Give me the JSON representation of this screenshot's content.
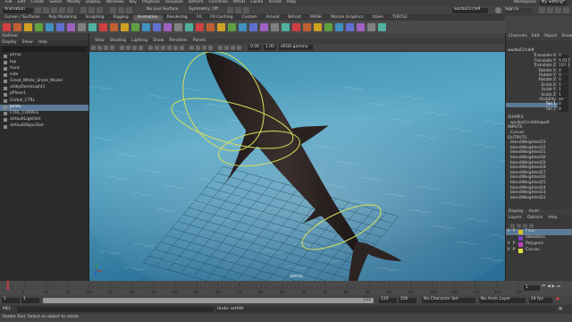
{
  "menubar": {
    "items": [
      "File",
      "Edit",
      "Create",
      "Select",
      "Modify",
      "Display",
      "Windows",
      "Key",
      "Playback",
      "Visualize",
      "Deform",
      "Constrain",
      "MASH",
      "Cache",
      "Arnold",
      "Help"
    ],
    "workspace_label": "Workspace:",
    "workspace_value": "My Setting*"
  },
  "statusline": {
    "mode": "Animation",
    "no_live_surface": "No Live Surface",
    "symmetry": "Symmetry: Off",
    "search_field": "wurboCircle9",
    "sign_in": "Sign In"
  },
  "shelf": {
    "tabs": [
      "Curves / Surfaces",
      "Poly Modeling",
      "Sculpting",
      "Rigging",
      "Animation",
      "Rendering",
      "FX",
      "FX Caching",
      "Custom",
      "Arnold",
      "Bifrost",
      "MASH",
      "Motion Graphics",
      "XGen",
      "TURTLE"
    ],
    "active_tab": "Animation"
  },
  "outliner": {
    "title": "Outliner",
    "menus": [
      "Display",
      "Show",
      "Help"
    ],
    "items": [
      {
        "label": "persp",
        "selected": false
      },
      {
        "label": "top",
        "selected": false
      },
      {
        "label": "front",
        "selected": false
      },
      {
        "label": "side",
        "selected": false
      },
      {
        "label": "Great_White_Shark_Model",
        "selected": false
      },
      {
        "label": "aiSkyDomeLight1",
        "selected": false
      },
      {
        "label": "pPlane1",
        "selected": false
      },
      {
        "label": "Global_CTRL",
        "selected": false
      },
      {
        "label": "Joints",
        "selected": true
      },
      {
        "label": "CTRL_CURVES",
        "selected": false
      },
      {
        "label": "defaultLightSet",
        "selected": false
      },
      {
        "label": "defaultObjectSet",
        "selected": false
      }
    ]
  },
  "viewport": {
    "menus": [
      "View",
      "Shading",
      "Lighting",
      "Show",
      "Renderer",
      "Panels"
    ],
    "field_a": "0.00",
    "field_b": "1.00",
    "colorspace": "sRGB gamma",
    "camera_label": "persp",
    "colors": {
      "water_top": "#3e8fb0",
      "water_mid": "#5aa8c6",
      "water_bottom": "#2a6f96",
      "shark_body": "#2f2826",
      "control_curve": "#d6e05a"
    }
  },
  "channelbox": {
    "tabs": [
      "Channels",
      "Edit",
      "Object",
      "Show"
    ],
    "node_name": "wurboCircle9",
    "channels": [
      {
        "name": "Translate X",
        "value": "0",
        "highlight": false
      },
      {
        "name": "Translate Y",
        "value": "5.017",
        "highlight": false
      },
      {
        "name": "Translate Z",
        "value": "107.1",
        "highlight": false
      },
      {
        "name": "Rotate X",
        "value": "0",
        "highlight": false
      },
      {
        "name": "Rotate Y",
        "value": "0",
        "highlight": false
      },
      {
        "name": "Rotate Z",
        "value": "0",
        "highlight": false
      },
      {
        "name": "Scale X",
        "value": "1",
        "highlight": false
      },
      {
        "name": "Scale Y",
        "value": "1",
        "highlight": false
      },
      {
        "name": "Scale Z",
        "value": "1",
        "highlight": false
      },
      {
        "name": "Visibility",
        "value": "on",
        "highlight": false
      },
      {
        "name": "Tail 1",
        "value": "0",
        "highlight": true
      },
      {
        "name": "Tail 2",
        "value": "0",
        "highlight": false
      }
    ],
    "shapes_label": "SHAPES",
    "shapes": [
      "wurboCircleShape9"
    ],
    "inputs_label": "INPUTS",
    "inputs": [
      "Curves"
    ],
    "outputs_label": "OUTPUTS",
    "outputs": [
      "blendWeighted33",
      "blendWeighted32",
      "blendWeighted31",
      "blendWeighted30",
      "blendWeighted29",
      "blendWeighted28",
      "blendWeighted27",
      "blendWeighted26",
      "blendWeighted25",
      "blendWeighted24",
      "blendWeighted23",
      "blendWeighted22"
    ]
  },
  "layers": {
    "tabs": [
      "Display",
      "Anim"
    ],
    "menus": [
      "Layers",
      "Options",
      "Help"
    ],
    "rows": [
      {
        "v": "V",
        "p": "P",
        "name": "Floor",
        "color": "#d8c020",
        "selected": true
      },
      {
        "v": "",
        "p": "",
        "name": "Skeletons",
        "color": "#8040c0",
        "selected": false
      },
      {
        "v": "V",
        "p": "P",
        "name": "Polygons",
        "color": "#c040c0",
        "selected": false
      },
      {
        "v": "V",
        "p": "P",
        "name": "Curves",
        "color": "#e0e040",
        "selected": false
      }
    ]
  },
  "timeline": {
    "ticks": [
      "5",
      "10",
      "15",
      "20",
      "25",
      "30",
      "35",
      "40",
      "45",
      "50",
      "55",
      "60",
      "65",
      "70",
      "75",
      "80",
      "85",
      "90",
      "95",
      "100",
      "105",
      "110",
      "115",
      "120"
    ],
    "current_frame": "1",
    "range_start": "1",
    "range_start_inner": "1",
    "range_end_inner": "122",
    "range_end": "120",
    "range_end_outer": "200",
    "no_character_set": "No Character Set",
    "no_anim_layer": "No Anim Layer",
    "fps": "24 fps"
  },
  "cmdline": {
    "lang": "MEL",
    "result": "Undo: setAttr"
  },
  "helpline": {
    "text": "Rotate Tool: Select an object to rotate"
  }
}
